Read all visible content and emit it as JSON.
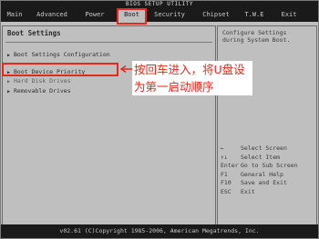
{
  "title_bar": "BIOS SETUP UTILITY",
  "menu": [
    {
      "label": "Main",
      "active": false
    },
    {
      "label": "Advanced",
      "active": false
    },
    {
      "label": "Power",
      "active": false
    },
    {
      "label": "Boot",
      "active": true
    },
    {
      "label": "Security",
      "active": false
    },
    {
      "label": "Chipset",
      "active": false
    },
    {
      "label": "T.W.E",
      "active": false
    },
    {
      "label": "Exit",
      "active": false
    }
  ],
  "panel": {
    "title": "Boot Settings",
    "options": [
      {
        "label": "Boot Settings Configuration",
        "dim": false
      },
      {
        "label": "Boot Device Priority",
        "dim": false
      },
      {
        "label": "Hard Disk Drives",
        "dim": true
      },
      {
        "label": "Removable Drives",
        "dim": false
      }
    ]
  },
  "help": {
    "text": "Configure Settings\nduring System Boot.",
    "keys": [
      {
        "key": "←",
        "desc": "Select Screen"
      },
      {
        "key": "↑↓",
        "desc": "Select Item"
      },
      {
        "key": "Enter",
        "desc": "Go to Sub Screen"
      },
      {
        "key": "F1",
        "desc": "General Help"
      },
      {
        "key": "F10",
        "desc": "Save and Exit"
      },
      {
        "key": "ESC",
        "desc": "Exit"
      }
    ]
  },
  "footer": "v02.61 (C)Copyright 1985-2006, American Megatrends, Inc.",
  "annotation": {
    "text": "按回车进入，将U盘设为第一启动顺序",
    "color": "#e8281c"
  }
}
